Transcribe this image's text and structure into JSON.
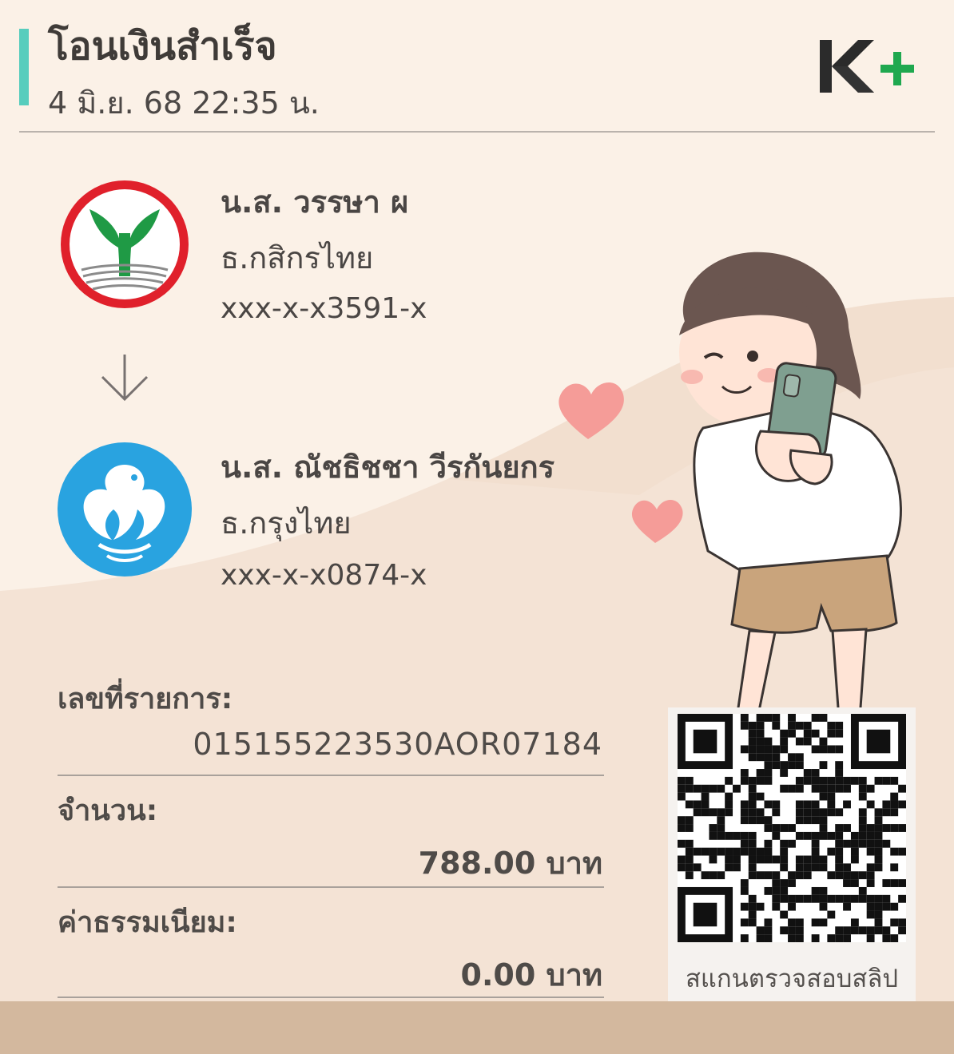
{
  "header": {
    "title": "โอนเงินสำเร็จ",
    "datetime": "4 มิ.ย. 68  22:35 น."
  },
  "sender": {
    "name": "น.ส. วรรษา ผ",
    "bank": "ธ.กสิกรไทย",
    "account": "xxx-x-x3591-x"
  },
  "receiver": {
    "name": "น.ส. ณัชธิชชา วีรกันยกร",
    "bank": "ธ.กรุงไทย",
    "account": "xxx-x-x0874-x"
  },
  "details": {
    "reference_label": "เลขที่รายการ:",
    "reference_value": "015155223530AOR07184",
    "amount_label": "จำนวน:",
    "amount_value": "788.00 บาท",
    "fee_label": "ค่าธรรมเนียม:",
    "fee_value": "0.00 บาท"
  },
  "qr": {
    "caption": "สแกนตรวจสอบสลิป"
  },
  "colors": {
    "accent_bar": "#57cdbd",
    "kbank_green": "#1f9a45",
    "kbank_ring": "#e0202b",
    "ktb_blue": "#29a3e0",
    "background": "#fbf1e7",
    "bottom_band": "#d3b89e"
  },
  "icons": {
    "brand": "k-plus-logo",
    "sender_bank": "kasikorn-bank-logo",
    "receiver_bank": "krungthai-bank-logo",
    "direction": "arrow-down-icon"
  }
}
